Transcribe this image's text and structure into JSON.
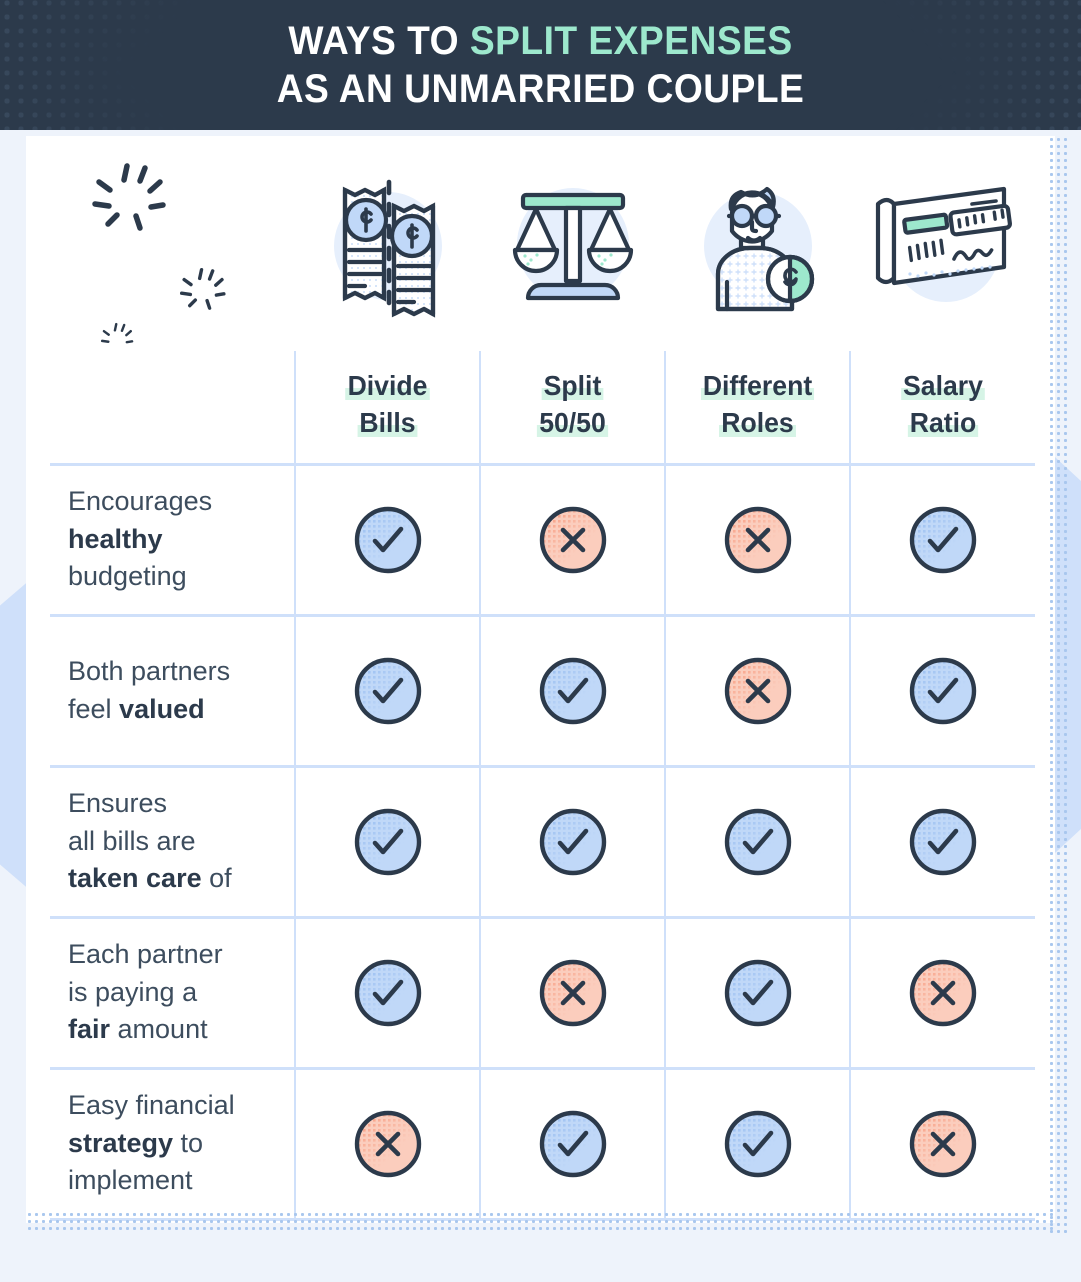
{
  "header": {
    "title_line1_plain": "WAYS TO ",
    "title_line1_accent": "SPLIT EXPENSES",
    "title_line2": "AS AN UNMARRIED COUPLE",
    "bg_color": "#2c3a4b",
    "accent_color": "#9de8cd"
  },
  "colors": {
    "yes_fill": "#c0d8f8",
    "yes_halftone": "#8cb5ee",
    "no_fill": "#fbcdbd",
    "no_halftone": "#f79071",
    "stroke": "#2c3a4b",
    "grid": "#cfe0fa",
    "mint_highlight": "#d6f4e6",
    "page_bg": "#eef3fb"
  },
  "table": {
    "columns": [
      {
        "id": "divide-bills",
        "label_line1": "Divide",
        "label_line2": "Bills",
        "icon": "split-bill-icon"
      },
      {
        "id": "split-5050",
        "label_line1": "Split",
        "label_line2": "50/50",
        "icon": "balance-scale-icon"
      },
      {
        "id": "different-roles",
        "label_line1": "Different",
        "label_line2": "Roles",
        "icon": "person-with-coin-icon"
      },
      {
        "id": "salary-ratio",
        "label_line1": "Salary",
        "label_line2": "Ratio",
        "icon": "paycheck-icon"
      }
    ],
    "rows": [
      {
        "id": "healthy-budgeting",
        "label_html": "Encourages<br><b>healthy</b><br>budgeting",
        "label_text": "Encourages healthy budgeting",
        "values": [
          "yes",
          "no",
          "no",
          "yes"
        ]
      },
      {
        "id": "both-partners-valued",
        "label_html": "Both partners<br>feel <b>valued</b>",
        "label_text": "Both partners feel valued",
        "values": [
          "yes",
          "yes",
          "no",
          "yes"
        ]
      },
      {
        "id": "all-bills-taken-care-of",
        "label_html": "Ensures<br>all bills are<br><b>taken care</b> of",
        "label_text": "Ensures all bills are taken care of",
        "values": [
          "yes",
          "yes",
          "yes",
          "yes"
        ]
      },
      {
        "id": "fair-amount",
        "label_html": "Each partner<br>is paying a<br><b>fair</b> amount",
        "label_text": "Each partner is paying a fair amount",
        "values": [
          "yes",
          "no",
          "yes",
          "no"
        ]
      },
      {
        "id": "easy-strategy",
        "label_html": "Easy financial<br><b>strategy</b> to<br>implement",
        "label_text": "Easy financial strategy to implement",
        "values": [
          "no",
          "yes",
          "yes",
          "no"
        ]
      }
    ]
  },
  "decor": {
    "sparkle_count": 3,
    "icon_names": [
      "sparkle-burst-icon",
      "split-bill-icon",
      "balance-scale-icon",
      "person-with-coin-icon",
      "paycheck-icon"
    ]
  }
}
